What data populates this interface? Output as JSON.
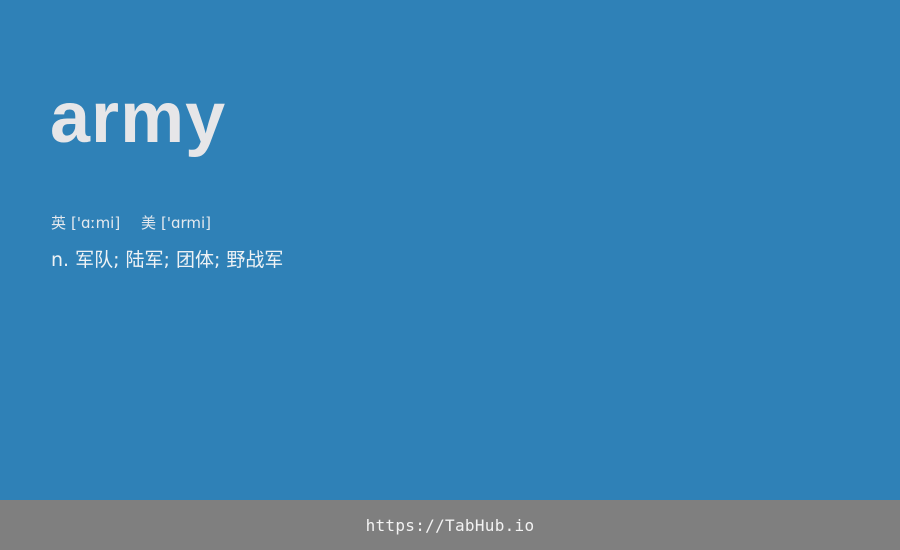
{
  "entry": {
    "word": "army",
    "phonetics": {
      "uk_label": "英",
      "uk_ipa": "['ɑːmi]",
      "us_label": "美",
      "us_ipa": "['ɑrmi]"
    },
    "definition": {
      "pos": "n.",
      "meanings": "军队; 陆军; 团体; 野战军"
    }
  },
  "footer": {
    "url": "https://TabHub.io"
  },
  "colors": {
    "card_background": "#2f81b7",
    "footer_background": "#7f7f7f",
    "word_text": "#e6e6e8"
  }
}
